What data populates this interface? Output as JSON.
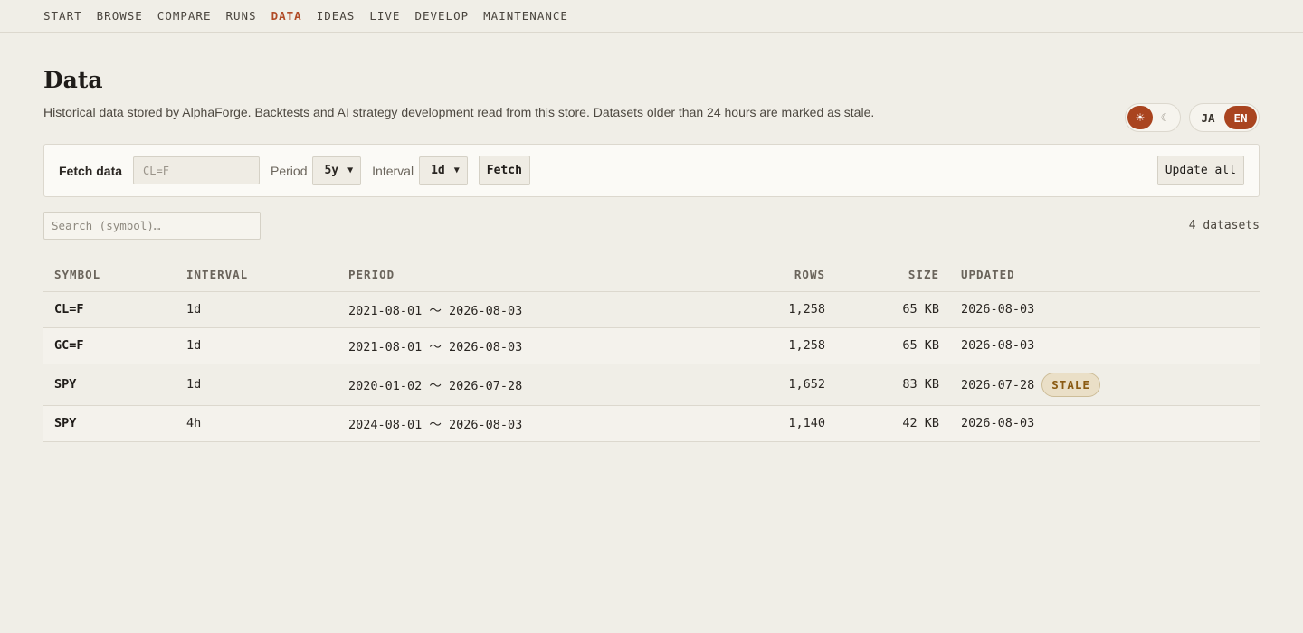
{
  "nav": {
    "items": [
      {
        "label": "START"
      },
      {
        "label": "BROWSE"
      },
      {
        "label": "COMPARE"
      },
      {
        "label": "RUNS"
      },
      {
        "label": "DATA"
      },
      {
        "label": "IDEAS"
      },
      {
        "label": "LIVE"
      },
      {
        "label": "DEVELOP"
      },
      {
        "label": "MAINTENANCE"
      }
    ],
    "active": "DATA"
  },
  "page": {
    "title": "Data",
    "description": "Historical data stored by AlphaForge. Backtests and AI strategy development read from this store. Datasets older than 24 hours are marked as stale."
  },
  "theme_toggle": {
    "light_icon": "☀",
    "dark_icon": "☾",
    "selected": "light"
  },
  "lang_toggle": {
    "ja": "JA",
    "en": "EN",
    "selected": "EN"
  },
  "fetch": {
    "label": "Fetch data",
    "symbol_placeholder": "CL=F",
    "period_label": "Period",
    "period_value": "5y",
    "interval_label": "Interval",
    "interval_value": "1d",
    "fetch_button": "Fetch",
    "update_all_button": "Update all"
  },
  "search": {
    "placeholder": "Search (symbol)…"
  },
  "dataset_count": "4 datasets",
  "table": {
    "headers": {
      "symbol": "SYMBOL",
      "interval": "INTERVAL",
      "period": "PERIOD",
      "rows": "ROWS",
      "size": "SIZE",
      "updated": "UPDATED"
    },
    "rows": [
      {
        "symbol": "CL=F",
        "interval": "1d",
        "period": "2021-08-01 〜 2026-08-03",
        "rows": "1,258",
        "size": "65 KB",
        "updated": "2026-08-03",
        "badge": ""
      },
      {
        "symbol": "GC=F",
        "interval": "1d",
        "period": "2021-08-01 〜 2026-08-03",
        "rows": "1,258",
        "size": "65 KB",
        "updated": "2026-08-03",
        "badge": ""
      },
      {
        "symbol": "SPY",
        "interval": "1d",
        "period": "2020-01-02 〜 2026-07-28",
        "rows": "1,652",
        "size": "83 KB",
        "updated": "2026-07-28",
        "badge": "STALE"
      },
      {
        "symbol": "SPY",
        "interval": "4h",
        "period": "2024-08-01 〜 2026-08-03",
        "rows": "1,140",
        "size": "42 KB",
        "updated": "2026-08-03",
        "badge": ""
      }
    ]
  },
  "colors": {
    "accent": "#a9441f",
    "stale_bg": "#eadfc7",
    "stale_text": "#8a5a12"
  }
}
